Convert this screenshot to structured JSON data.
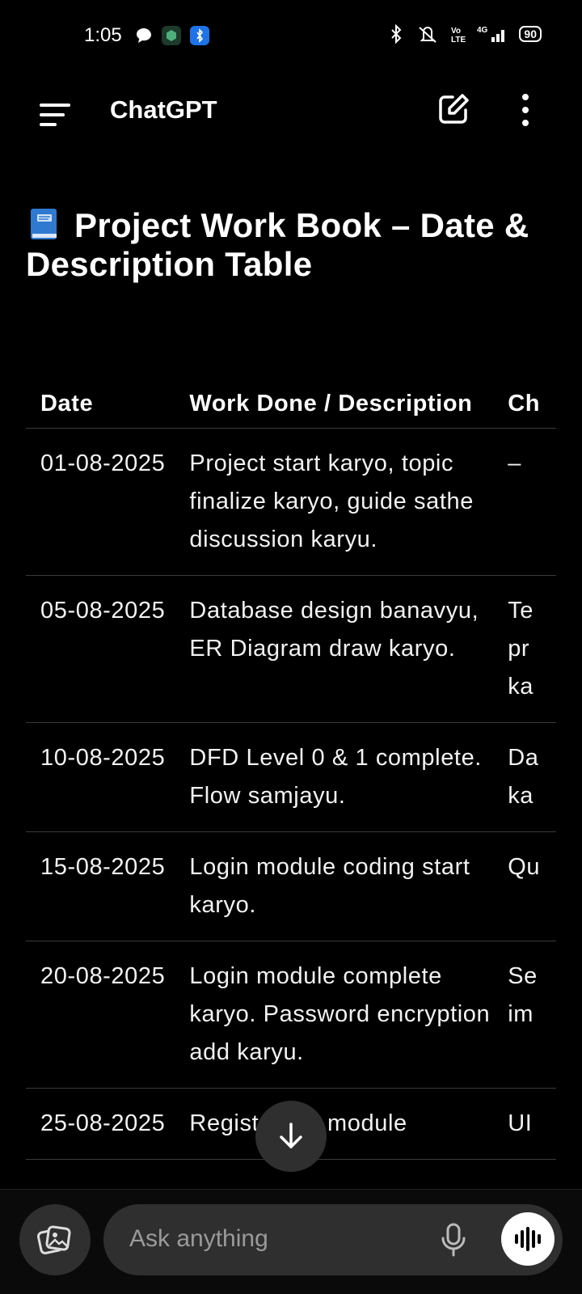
{
  "status_bar": {
    "time": "1:05",
    "battery": "90"
  },
  "header": {
    "title": "ChatGPT"
  },
  "content": {
    "heading": "Project Work Book – Date & Description Table",
    "table": {
      "columns": [
        "Date",
        "Work Done / Description",
        "Ch"
      ],
      "rows": [
        {
          "date": "01-08-2025",
          "desc": "Project start karyo, topic finalize karyo, guide sathe discussion karyu.",
          "ch": "–"
        },
        {
          "date": "05-08-2025",
          "desc": "Database design banavyu, ER Diagram draw karyo.",
          "ch": "Te\npr\nka"
        },
        {
          "date": "10-08-2025",
          "desc": "DFD Level 0 & 1 complete. Flow samjayu.",
          "ch": "Da\nka"
        },
        {
          "date": "15-08-2025",
          "desc": "Login module coding start karyo.",
          "ch": "Qu"
        },
        {
          "date": "20-08-2025",
          "desc": "Login module complete karyo. Password encryption add karyu.",
          "ch": "Se\nim"
        },
        {
          "date": "25-08-2025",
          "desc": "Registration module",
          "ch": "UI"
        }
      ]
    }
  },
  "composer": {
    "placeholder": "Ask anything"
  }
}
